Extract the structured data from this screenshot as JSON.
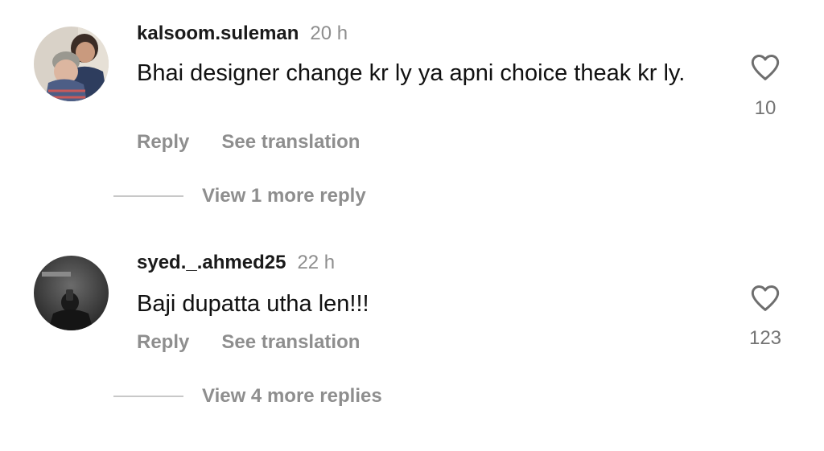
{
  "comments": [
    {
      "username": "kalsoom.suleman",
      "time": "20 h",
      "text": "Bhai designer change kr ly ya apni choice theak kr ly.",
      "reply_label": "Reply",
      "translation_label": "See translation",
      "likes": "10",
      "view_replies_label": "View 1 more reply"
    },
    {
      "username": "syed._.ahmed25",
      "time": "22 h",
      "text": "Baji dupatta utha len!!!",
      "reply_label": "Reply",
      "translation_label": "See translation",
      "likes": "123",
      "view_replies_label": "View 4 more replies"
    }
  ],
  "icons": {
    "like": "heart-outline-icon"
  },
  "colors": {
    "secondary_text": "#8e8e8e",
    "like_count": "#737373",
    "divider": "#c8c8c8"
  }
}
